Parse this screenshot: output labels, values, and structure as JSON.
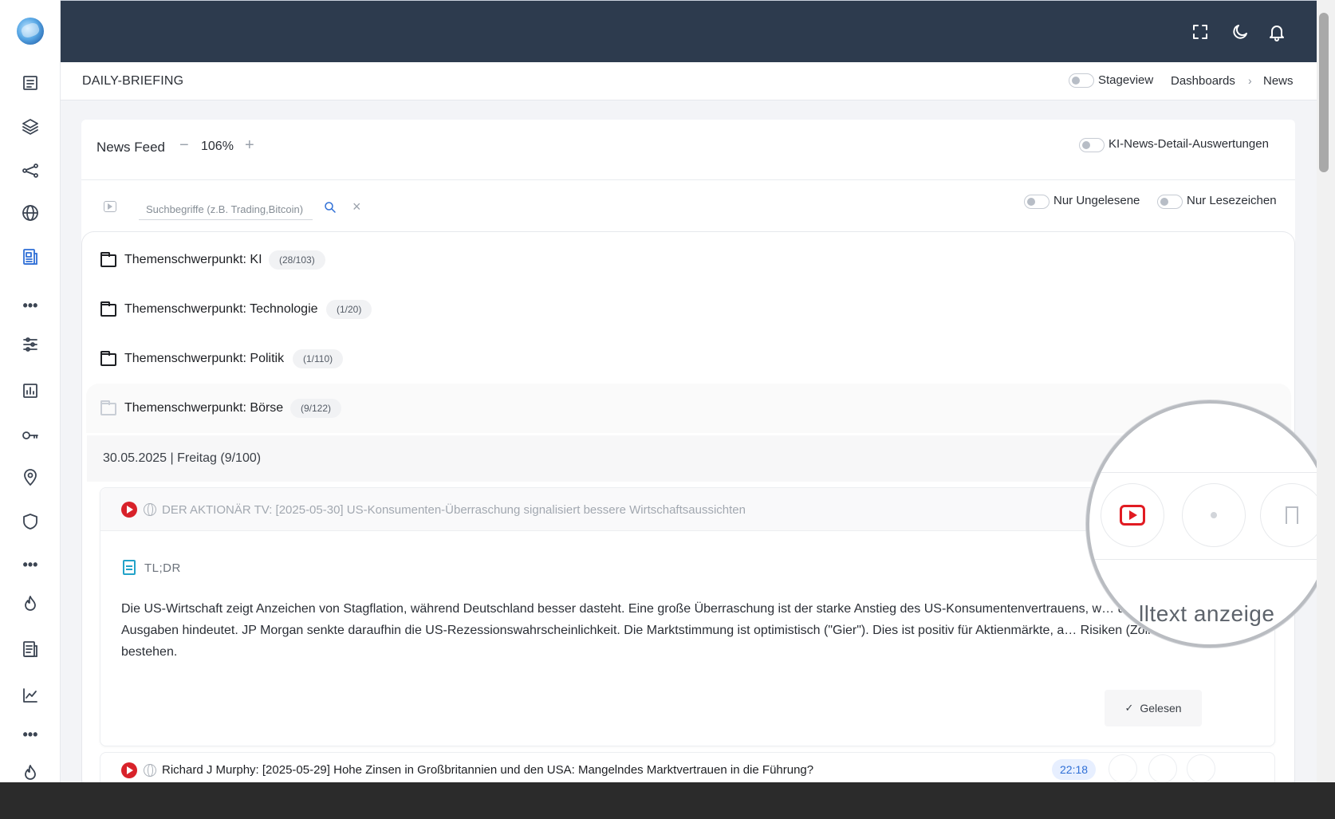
{
  "topbar": {
    "icons": [
      "fullscreen-icon",
      "moon-icon",
      "bell-icon"
    ]
  },
  "subbar": {
    "page_title": "DAILY-BRIEFING",
    "stageview_label": "Stageview",
    "breadcrumb": [
      "Dashboards",
      "News"
    ]
  },
  "sidebar": {
    "icons": [
      "news-list-icon",
      "layers-icon",
      "share-icon",
      "globe-icon",
      "newspaper-icon",
      "more-icon",
      "sliders-icon",
      "chart-icon",
      "key-icon",
      "location-icon",
      "shield-icon",
      "more-icon",
      "flame-icon",
      "report-icon",
      "trend-icon",
      "more-icon",
      "flame-icon"
    ],
    "active": "newspaper-icon"
  },
  "feed": {
    "title": "News Feed",
    "zoom_minus": "−",
    "zoom_value": "106%",
    "zoom_plus": "+",
    "ki_toggle_label": "KI-News-Detail-Auswertungen",
    "search_placeholder": "Suchbegriffe (z.B. Trading,Bitcoin)",
    "clear_symbol": "×",
    "only_unread_label": "Nur Ungelesene",
    "only_bookmarks_label": "Nur Lesezeichen"
  },
  "folders": [
    {
      "label": "Themenschwerpunkt: KI",
      "count": "(28/103)"
    },
    {
      "label": "Themenschwerpunkt: Technologie",
      "count": "(1/20)"
    },
    {
      "label": "Themenschwerpunkt: Politik",
      "count": "(1/110)"
    },
    {
      "label": "Themenschwerpunkt: Börse",
      "count": "(9/122)"
    }
  ],
  "date_group": {
    "label": "30.05.2025 | Freitag (9/100)"
  },
  "news": [
    {
      "title": "DER AKTIONÄR TV: [2025-05-30] US-Konsumenten-Überraschung signalisiert bessere Wirtschaftsaussichten",
      "tldr_label": "TL;DR",
      "summary": "Die US-Wirtschaft zeigt Anzeichen von Stagflation, während Deutschland besser dasteht. Eine große Überraschung ist der starke Anstieg des US-Konsumentenvertrauens, w… und höhere Ausgaben hindeutet. JP Morgan senkte daraufhin die US-Rezessionswahrscheinlichkeit. Die Marktstimmung ist optimistisch (\"Gier\"). Dies ist positiv für Aktienmärkte, a… Risiken (Zölle) bleiben bestehen.",
      "read_label": "Gelesen",
      "check": "✓"
    },
    {
      "title": "Richard J Murphy: [2025-05-29] Hohe Zinsen in Großbritannien und den USA: Mangelndes Marktvertrauen in die Führung?",
      "duration": "22:18"
    }
  ],
  "magnifier": {
    "text": "lltext anzeige"
  },
  "colors": {
    "topbar": "#2d3b4e",
    "accent": "#2f6fd6",
    "youtube": "#d8222a",
    "tldr": "#23a3c9"
  }
}
